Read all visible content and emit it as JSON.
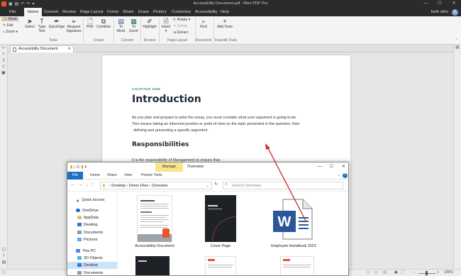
{
  "app": {
    "window_title": "Accessibility Document.pdf - Nitro PDF Pro",
    "user_name": "beth nitro",
    "avatar_initial": "b"
  },
  "menu": [
    "File",
    "Home",
    "Convert",
    "Review",
    "Page Layout",
    "Forms",
    "Share",
    "Erase",
    "Protect",
    "Customize",
    "Accessibility",
    "Help"
  ],
  "ribbon": {
    "hand": "Hand",
    "edit": "Edit",
    "zoom": "Zoom",
    "select": "Select",
    "type_text": "Type Text",
    "quicksign": "QuickSign",
    "request_signature": "Request Signature",
    "pdf": "PDF",
    "combine": "Combine",
    "to_word": "To Word",
    "to_excel": "To Excel",
    "highlight": "Highlight",
    "insert": "Insert",
    "rotate": "Rotate",
    "delete": "Delete",
    "extract": "Extract",
    "find": "Find",
    "add_tools": "Add Tools",
    "groups": {
      "tools": "Tools",
      "create": "Create",
      "convert": "Convert",
      "review": "Review",
      "page_layout": "Page Layout",
      "document": "Document",
      "favorite_tools": "Favorite Tools"
    }
  },
  "doc_tab": "Accessibility Document",
  "document": {
    "chapter": "CHAPTER ONE",
    "title": "Introduction",
    "paragraph_line1": "As you plan and prepare to write the essay, you must consider what your argument is going to be.",
    "paragraph_line2": "This means taking an informed position or point of view on the topic presented in the question, then",
    "paragraph_line3": "defining and presenting a specific argument.",
    "heading2": "Responsibilities",
    "paragraph2": "It is the responsibility of Management to ensure that:"
  },
  "status": {
    "zoom": "100%"
  },
  "explorer": {
    "manage": "Manage",
    "title": "Overview",
    "ribbon_tabs": [
      "File",
      "Home",
      "Share",
      "View",
      "Picture Tools"
    ],
    "breadcrumb": [
      "Desktop",
      "Demo Files",
      "Overview"
    ],
    "search_placeholder": "Search Overview",
    "nav": [
      "Quick access",
      "OneDrive",
      "AppData",
      "Desktop",
      "Documents",
      "Pictures",
      "This PC",
      "3D Objects",
      "Desktop",
      "Documents"
    ],
    "files": [
      "Accessibility Document",
      "Cover Page",
      "Employee Handbook 2023"
    ]
  },
  "colors": {
    "nitro_dark": "#2b2b2b",
    "accent_teal": "#2b8a7e",
    "word_blue": "#2b579a",
    "arrow_red": "#cc2a2a",
    "explorer_blue": "#1f6fc5"
  }
}
